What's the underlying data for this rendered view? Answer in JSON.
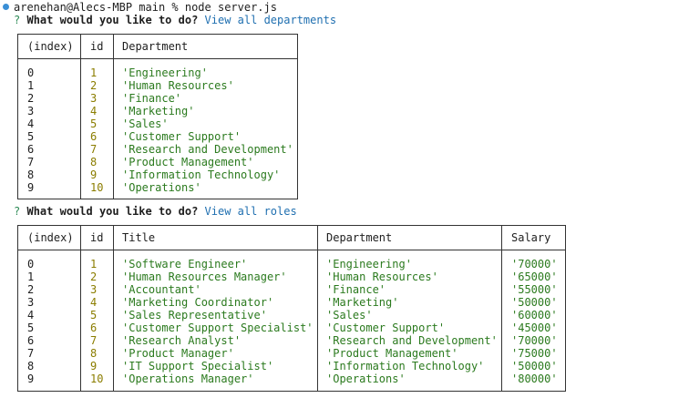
{
  "prompt_line": "arenehan@Alecs-MBP main % node server.js",
  "q1": {
    "mark": "?",
    "question": "What would you like to do?",
    "answer": "View all departments"
  },
  "departments_table": {
    "columns": [
      "(index)",
      "id",
      "Department"
    ],
    "rows": [
      [
        "0",
        "1",
        "'Engineering'"
      ],
      [
        "1",
        "2",
        "'Human Resources'"
      ],
      [
        "2",
        "3",
        "'Finance'"
      ],
      [
        "3",
        "4",
        "'Marketing'"
      ],
      [
        "4",
        "5",
        "'Sales'"
      ],
      [
        "5",
        "6",
        "'Customer Support'"
      ],
      [
        "6",
        "7",
        "'Research and Development'"
      ],
      [
        "7",
        "8",
        "'Product Management'"
      ],
      [
        "8",
        "9",
        "'Information Technology'"
      ],
      [
        "9",
        "10",
        "'Operations'"
      ]
    ]
  },
  "q2": {
    "mark": "?",
    "question": "What would you like to do?",
    "answer": "View all roles"
  },
  "roles_table": {
    "columns": [
      "(index)",
      "id",
      "Title",
      "Department",
      "Salary"
    ],
    "rows": [
      [
        "0",
        "1",
        "'Software Engineer'",
        "'Engineering'",
        "'70000'"
      ],
      [
        "1",
        "2",
        "'Human Resources Manager'",
        "'Human Resources'",
        "'65000'"
      ],
      [
        "2",
        "3",
        "'Accountant'",
        "'Finance'",
        "'55000'"
      ],
      [
        "3",
        "4",
        "'Marketing Coordinator'",
        "'Marketing'",
        "'50000'"
      ],
      [
        "4",
        "5",
        "'Sales Representative'",
        "'Sales'",
        "'60000'"
      ],
      [
        "5",
        "6",
        "'Customer Support Specialist'",
        "'Customer Support'",
        "'45000'"
      ],
      [
        "6",
        "7",
        "'Research Analyst'",
        "'Research and Development'",
        "'70000'"
      ],
      [
        "7",
        "8",
        "'Product Manager'",
        "'Product Management'",
        "'75000'"
      ],
      [
        "8",
        "9",
        "'IT Support Specialist'",
        "'Information Technology'",
        "'50000'"
      ],
      [
        "9",
        "10",
        "'Operations Manager'",
        "'Operations'",
        "'80000'"
      ]
    ]
  },
  "colors": {
    "prompt_dot": "#3a8fd6",
    "question_mark": "#2e8b57",
    "answer": "#1f6fb0",
    "number": "#8b7d00",
    "string": "#2b7a1e"
  }
}
